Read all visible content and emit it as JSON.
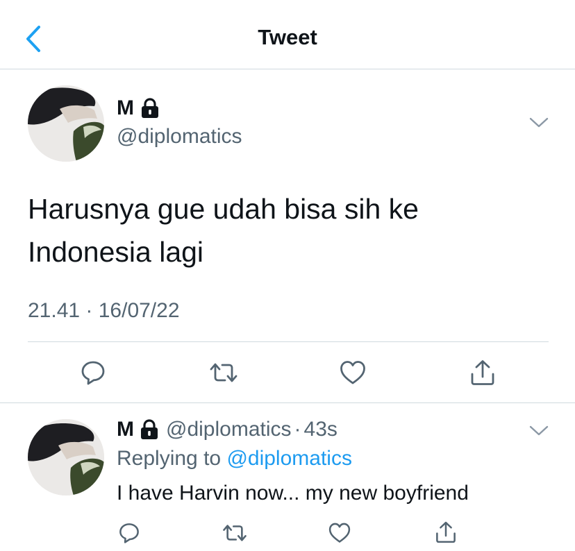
{
  "nav": {
    "title": "Tweet",
    "back_icon": "chevron-left-icon"
  },
  "colors": {
    "accent": "#1d9bf0",
    "back_chevron": "#1da1f2",
    "text_primary": "#0f1419",
    "text_secondary": "#536471",
    "divider": "#cfd9de"
  },
  "tweet": {
    "author_name": "M",
    "protected_icon": "lock-icon",
    "handle": "@diplomatics",
    "text_line1": "Harusnya gue udah bisa sih ke",
    "text_line2": "Indonesia lagi",
    "timestamp": "21.41 · 16/07/22",
    "menu_icon": "chevron-down-icon",
    "actions": [
      "reply-icon",
      "retweet-icon",
      "like-icon",
      "share-icon"
    ]
  },
  "reply": {
    "author_name": "M",
    "protected_icon": "lock-icon",
    "handle": "@diplomatics",
    "separator": "·",
    "time": "43s",
    "replying_prefix": "Replying to",
    "replying_to": "@diplomatics",
    "text": "I have Harvin now... my new boyfriend",
    "menu_icon": "chevron-down-icon",
    "actions": [
      "reply-icon",
      "retweet-icon",
      "like-icon",
      "share-icon"
    ]
  }
}
